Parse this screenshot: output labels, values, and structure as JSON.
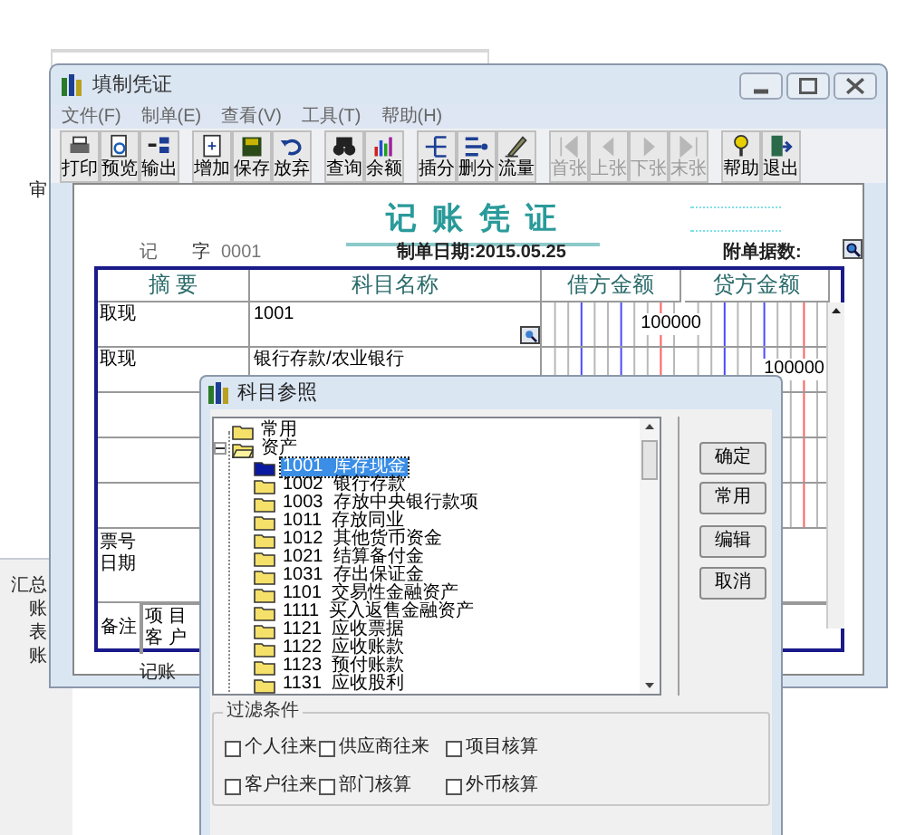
{
  "background_items": [
    {
      "label": "审"
    },
    {
      "label": "汇总"
    },
    {
      "label": "账"
    },
    {
      "label": "表"
    },
    {
      "label": "账"
    }
  ],
  "window": {
    "title": "填制凭证"
  },
  "menu": [
    "文件(F)",
    "制单(E)",
    "查看(V)",
    "工具(T)",
    "帮助(H)"
  ],
  "toolbar": [
    [
      {
        "label": "打印",
        "disabled": false
      },
      {
        "label": "预览",
        "disabled": false
      },
      {
        "label": "输出",
        "disabled": false
      }
    ],
    [
      {
        "label": "增加",
        "disabled": false
      },
      {
        "label": "保存",
        "disabled": false
      },
      {
        "label": "放弃",
        "disabled": false
      }
    ],
    [
      {
        "label": "查询",
        "disabled": false
      },
      {
        "label": "余额",
        "disabled": false
      }
    ],
    [
      {
        "label": "插分",
        "disabled": false
      },
      {
        "label": "删分",
        "disabled": false
      },
      {
        "label": "流量",
        "disabled": false
      }
    ],
    [
      {
        "label": "首张",
        "disabled": true
      },
      {
        "label": "上张",
        "disabled": true
      },
      {
        "label": "下张",
        "disabled": true
      },
      {
        "label": "末张",
        "disabled": true
      }
    ],
    [
      {
        "label": "帮助",
        "disabled": false
      },
      {
        "label": "退出",
        "disabled": false
      }
    ]
  ],
  "voucher": {
    "title": "记 账 凭 证",
    "type_label": "记",
    "number_label": "字",
    "number": "0001",
    "date": "制单日期:2015.05.25",
    "attachments_label": "附单据数:",
    "columns": [
      "摘 要",
      "科目名称",
      "借方金额",
      "贷方金额"
    ],
    "rows": [
      {
        "summary": "取现",
        "account": "1001",
        "debit": "100000"
      },
      {
        "summary": "取现",
        "account": "银行存款/农业银行",
        "credit": "100000"
      }
    ],
    "ticket_label": "票号",
    "date_label": "日期",
    "note_label": "备注",
    "project_label": "项 目",
    "customer_label": "客 户",
    "footer_label": "记账"
  },
  "dialog": {
    "title": "科目参照",
    "tree": [
      {
        "label": "常用"
      },
      {
        "label": "资产",
        "expanded": true,
        "children": [
          {
            "label": "1001  库存现金",
            "selected": true
          },
          {
            "label": "1002  银行存款",
            "selected": false
          },
          {
            "label": "1003  存放中央银行款项",
            "selected": false
          },
          {
            "label": "1011  存放同业",
            "selected": false
          },
          {
            "label": "1012  其他货币资金",
            "selected": false
          },
          {
            "label": "1021  结算备付金",
            "selected": false
          },
          {
            "label": "1031  存出保证金",
            "selected": false
          },
          {
            "label": "1101  交易性金融资产",
            "selected": false
          },
          {
            "label": "1111  买入返售金融资产",
            "selected": false
          },
          {
            "label": "1121  应收票据",
            "selected": false
          },
          {
            "label": "1122  应收账款",
            "selected": false
          },
          {
            "label": "1123  预付账款",
            "selected": false
          },
          {
            "label": "1131  应收股利",
            "selected": false
          }
        ]
      }
    ],
    "buttons": [
      "确定",
      "常用",
      "编辑",
      "取消"
    ],
    "filter": {
      "title": "过滤条件",
      "options": [
        {
          "label": "个人往来",
          "checked": false
        },
        {
          "label": "供应商往来",
          "checked": false
        },
        {
          "label": "项目核算",
          "checked": false
        },
        {
          "label": "客户往来",
          "checked": false
        },
        {
          "label": "部门核算",
          "checked": false
        },
        {
          "label": "外币核算",
          "checked": false
        }
      ]
    }
  }
}
